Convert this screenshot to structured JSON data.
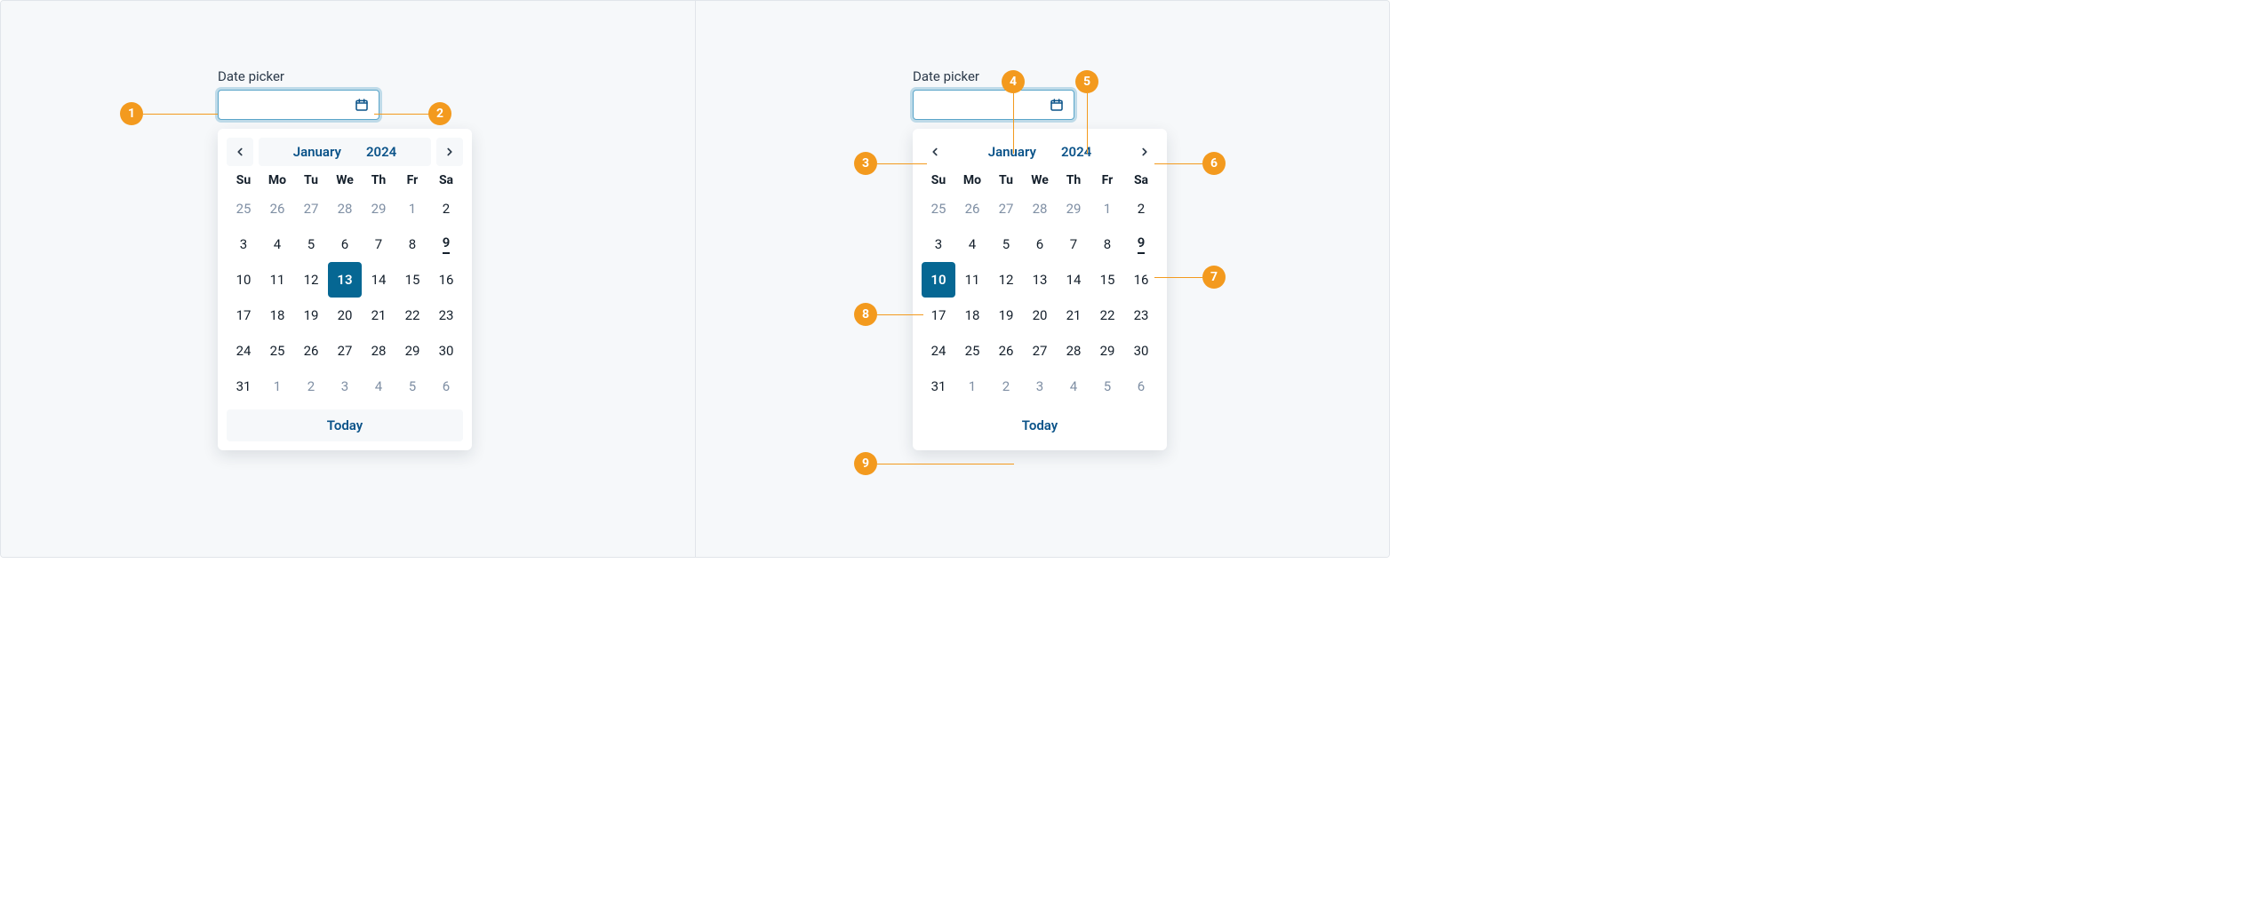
{
  "label": "Date picker",
  "month": "January",
  "year": "2024",
  "today_label": "Today",
  "dow": [
    "Su",
    "Mo",
    "Tu",
    "We",
    "Th",
    "Fr",
    "Sa"
  ],
  "left": {
    "selected_day": "13",
    "today_day": "9",
    "annotations": [
      "1",
      "2"
    ],
    "grid": [
      {
        "d": "25",
        "out": true
      },
      {
        "d": "26",
        "out": true
      },
      {
        "d": "27",
        "out": true
      },
      {
        "d": "28",
        "out": true
      },
      {
        "d": "29",
        "out": true
      },
      {
        "d": "1",
        "out": true
      },
      {
        "d": "2"
      },
      {
        "d": "3"
      },
      {
        "d": "4"
      },
      {
        "d": "5"
      },
      {
        "d": "6"
      },
      {
        "d": "7"
      },
      {
        "d": "8"
      },
      {
        "d": "9",
        "today": true
      },
      {
        "d": "10"
      },
      {
        "d": "11"
      },
      {
        "d": "12"
      },
      {
        "d": "13",
        "sel": true
      },
      {
        "d": "14"
      },
      {
        "d": "15"
      },
      {
        "d": "16"
      },
      {
        "d": "17"
      },
      {
        "d": "18"
      },
      {
        "d": "19"
      },
      {
        "d": "20"
      },
      {
        "d": "21"
      },
      {
        "d": "22"
      },
      {
        "d": "23"
      },
      {
        "d": "24"
      },
      {
        "d": "25"
      },
      {
        "d": "26"
      },
      {
        "d": "27"
      },
      {
        "d": "28"
      },
      {
        "d": "29"
      },
      {
        "d": "30"
      },
      {
        "d": "31"
      },
      {
        "d": "1",
        "out": true
      },
      {
        "d": "2",
        "out": true
      },
      {
        "d": "3",
        "out": true
      },
      {
        "d": "4",
        "out": true
      },
      {
        "d": "5",
        "out": true
      },
      {
        "d": "6",
        "out": true
      }
    ]
  },
  "right": {
    "selected_day": "10",
    "today_day": "9",
    "annotations": [
      "3",
      "4",
      "5",
      "6",
      "7",
      "8",
      "9"
    ],
    "grid": [
      {
        "d": "25",
        "out": true
      },
      {
        "d": "26",
        "out": true
      },
      {
        "d": "27",
        "out": true
      },
      {
        "d": "28",
        "out": true
      },
      {
        "d": "29",
        "out": true
      },
      {
        "d": "1",
        "out": true
      },
      {
        "d": "2"
      },
      {
        "d": "3"
      },
      {
        "d": "4"
      },
      {
        "d": "5"
      },
      {
        "d": "6"
      },
      {
        "d": "7"
      },
      {
        "d": "8"
      },
      {
        "d": "9",
        "today": true
      },
      {
        "d": "10",
        "sel": true
      },
      {
        "d": "11"
      },
      {
        "d": "12"
      },
      {
        "d": "13"
      },
      {
        "d": "14"
      },
      {
        "d": "15"
      },
      {
        "d": "16"
      },
      {
        "d": "17"
      },
      {
        "d": "18"
      },
      {
        "d": "19"
      },
      {
        "d": "20"
      },
      {
        "d": "21"
      },
      {
        "d": "22"
      },
      {
        "d": "23"
      },
      {
        "d": "24"
      },
      {
        "d": "25"
      },
      {
        "d": "26"
      },
      {
        "d": "27"
      },
      {
        "d": "28"
      },
      {
        "d": "29"
      },
      {
        "d": "30"
      },
      {
        "d": "31"
      },
      {
        "d": "1",
        "out": true
      },
      {
        "d": "2",
        "out": true
      },
      {
        "d": "3",
        "out": true
      },
      {
        "d": "4",
        "out": true
      },
      {
        "d": "5",
        "out": true
      },
      {
        "d": "6",
        "out": true
      }
    ]
  }
}
